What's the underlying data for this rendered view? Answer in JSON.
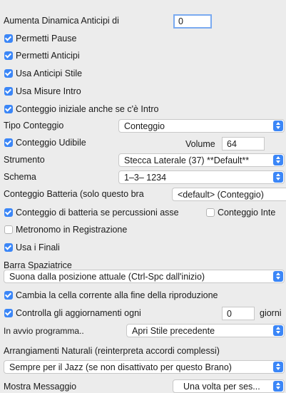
{
  "anticipi_label": "Aumenta Dinamica Anticipi di",
  "anticipi_value": "0",
  "permetti_pause": "Permetti Pause",
  "permetti_anticipi": "Permetti Anticipi",
  "usa_anticipi_stile": "Usa Anticipi Stile",
  "usa_misure_intro": "Usa Misure Intro",
  "conteggio_iniziale": "Conteggio iniziale anche se c'è  Intro",
  "tipo_conteggio_label": "Tipo Conteggio",
  "tipo_conteggio_value": "Conteggio",
  "conteggio_udibile": "Conteggio Udibile",
  "volume_label": "Volume",
  "volume_value": "64",
  "strumento_label": "Strumento",
  "strumento_value": "Stecca Laterale (37) **Default**",
  "schema_label": "Schema",
  "schema_value": "1–3– 1234",
  "conteggio_batteria_label": "Conteggio Batteria (solo questo bra",
  "conteggio_batteria_value": "<default> (Conteggio)",
  "conteggio_percussioni": "Conteggio di batteria se percussioni asse",
  "conteggio_inte": "Conteggio Inte",
  "metronomo": "Metronomo in Registrazione",
  "usa_finali": "Usa i Finali",
  "barra_spaziatrice_label": "Barra Spaziatrice",
  "barra_spaziatrice_value": "Suona dalla posizione attuale (Ctrl-Spc dall'inizio)",
  "cambia_cella": "Cambia la cella corrente alla fine della riproduzione",
  "controlla_aggiornamenti": "Controlla gli aggiornamenti ogni",
  "aggiornamenti_value": "0",
  "giorni_label": "giorni",
  "avvio_label": "In avvio programma..",
  "avvio_value": "Apri Stile precedente",
  "arrangiamenti_label": "Arrangiamenti Naturali (reinterpreta accordi complessi)",
  "arrangiamenti_value": "Sempre per il Jazz (se non disattivato per questo Brano)",
  "mostra_messaggio_label": "Mostra Messaggio",
  "mostra_messaggio_value": "Una volta per ses...",
  "colors": {
    "accent": "#3b86f7",
    "background": "#ececec"
  }
}
